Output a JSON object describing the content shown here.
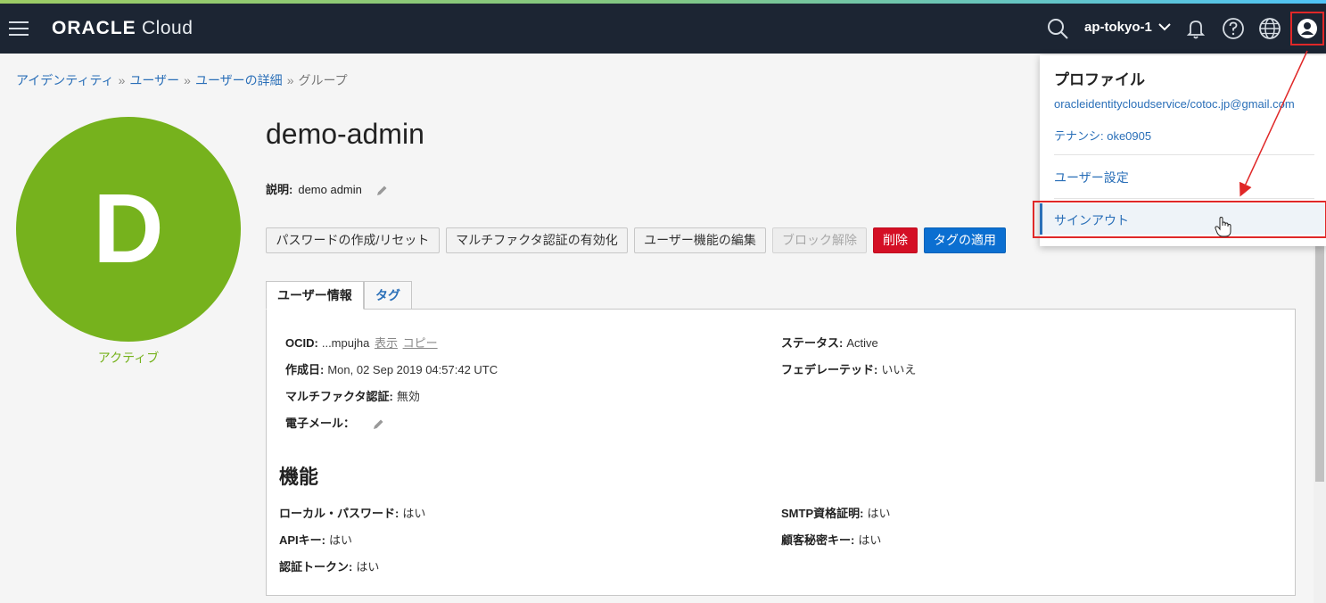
{
  "header": {
    "brand_bold": "ORACLE",
    "brand_light": "Cloud",
    "region": "ap-tokyo-1"
  },
  "breadcrumb": {
    "items": [
      "アイデンティティ",
      "ユーザー",
      "ユーザーの詳細"
    ],
    "current": "グループ",
    "separator": "»"
  },
  "user": {
    "initial": "D",
    "status": "アクティブ",
    "name": "demo-admin",
    "description_label": "説明:",
    "description": "demo admin"
  },
  "actions": [
    "パスワードの作成/リセット",
    "マルチファクタ認証の有効化",
    "ユーザー機能の編集",
    "ブロック解除",
    "削除",
    "タグの適用"
  ],
  "tabs": [
    "ユーザー情報",
    "タグ"
  ],
  "info": {
    "ocid_label": "OCID:",
    "ocid_value": "...mpujha",
    "ocid_show": "表示",
    "ocid_copy": "コピー",
    "created_label": "作成日:",
    "created_value": "Mon, 02 Sep 2019 04:57:42 UTC",
    "mfa_label": "マルチファクタ認証:",
    "mfa_value": "無効",
    "email_label": "電子メール：",
    "status_label": "ステータス:",
    "status_value": "Active",
    "federated_label": "フェデレーテッド:",
    "federated_value": "いいえ"
  },
  "capabilities": {
    "title": "機能",
    "local_pw_label": "ローカル・パスワード:",
    "local_pw_value": "はい",
    "api_key_label": "APIキー:",
    "api_key_value": "はい",
    "auth_token_label": "認証トークン:",
    "auth_token_value": "はい",
    "smtp_label": "SMTP資格証明:",
    "smtp_value": "はい",
    "customer_key_label": "顧客秘密キー:",
    "customer_key_value": "はい"
  },
  "profile_menu": {
    "title": "プロファイル",
    "email": "oracleidentitycloudservice/cotoc.jp@gmail.com",
    "tenancy": "テナンシ: oke0905",
    "settings": "ユーザー設定",
    "signout": "サインアウト"
  },
  "colors": {
    "topbar": "#1c2533",
    "avatar_green": "#76b21d",
    "link_blue": "#2a6fb8",
    "danger_red": "#d40f25",
    "primary_blue": "#0b6fd1",
    "annotation_red": "#e02828"
  }
}
